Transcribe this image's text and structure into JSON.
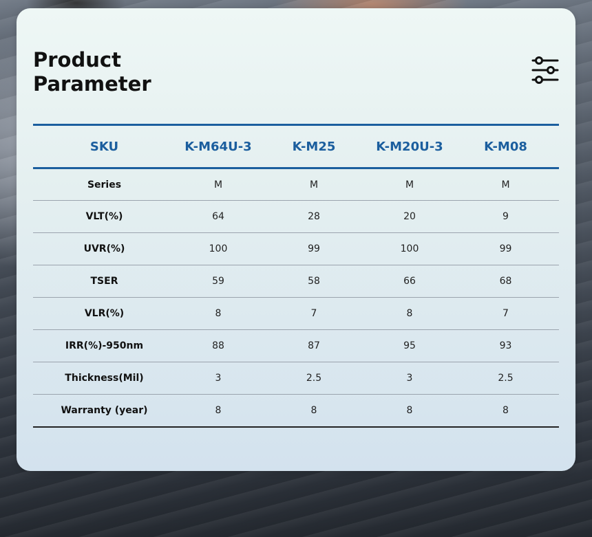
{
  "title": {
    "line1": "Product",
    "line2": "Parameter"
  },
  "icons": {
    "filter": "sliders-icon"
  },
  "table": {
    "headers": [
      "SKU",
      "K-M64U-3",
      "K-M25",
      "K-M20U-3",
      "K-M08"
    ],
    "rows": [
      {
        "label": "Series",
        "values": [
          "M",
          "M",
          "M",
          "M"
        ]
      },
      {
        "label": "VLT(%)",
        "values": [
          "64",
          "28",
          "20",
          "9"
        ]
      },
      {
        "label": "UVR(%)",
        "values": [
          "100",
          "99",
          "100",
          "99"
        ]
      },
      {
        "label": "TSER",
        "values": [
          "59",
          "58",
          "66",
          "68"
        ]
      },
      {
        "label": "VLR(%)",
        "values": [
          "8",
          "7",
          "8",
          "7"
        ]
      },
      {
        "label": "IRR(%)-950nm",
        "values": [
          "88",
          "87",
          "95",
          "93"
        ]
      },
      {
        "label": "Thickness(Mil)",
        "values": [
          "3",
          "2.5",
          "3",
          "2.5"
        ]
      },
      {
        "label": "Warranty (year)",
        "values": [
          "8",
          "8",
          "8",
          "8"
        ]
      }
    ]
  },
  "colors": {
    "accent": "#1b5e9e",
    "text": "#111111"
  }
}
